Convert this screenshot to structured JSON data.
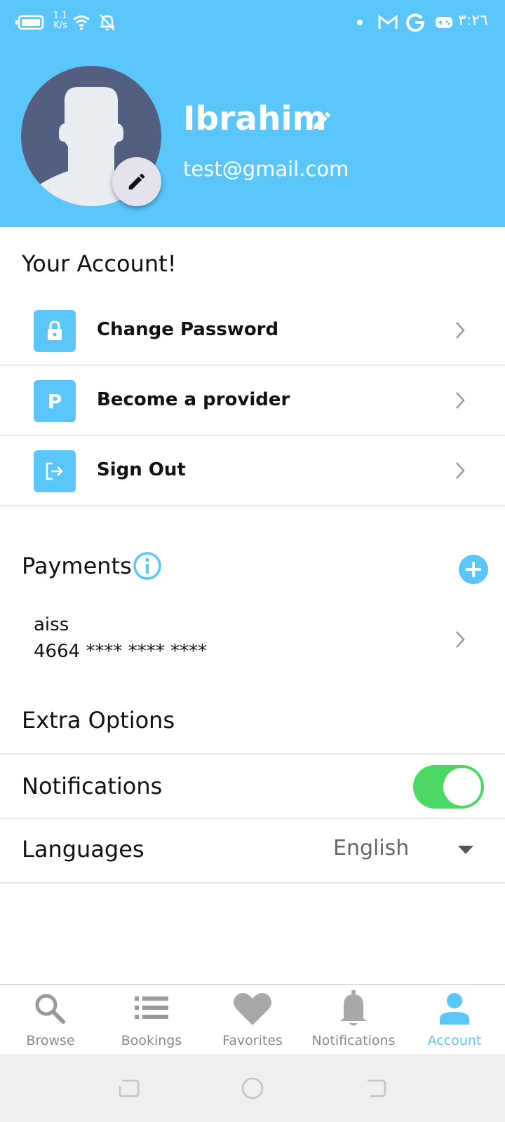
{
  "status_bar": {
    "speed_value": "1.1",
    "speed_unit": "K/s",
    "time": "٣:٢٦",
    "icons": [
      "battery-icon",
      "wifi-icon",
      "notifications-off-icon",
      "dot-icon",
      "gmail-icon",
      "google-icon",
      "game-icon"
    ]
  },
  "profile": {
    "name": "Ibrahim",
    "email": "test@gmail.com"
  },
  "account_section": {
    "title": "Your Account!",
    "items": [
      {
        "label": "Change Password",
        "icon": "lock-icon"
      },
      {
        "label": "Become a provider",
        "icon": "p-icon",
        "icon_text": "P"
      },
      {
        "label": "Sign Out",
        "icon": "sign-out-icon"
      }
    ]
  },
  "payments": {
    "title": "Payments",
    "card": {
      "holder": "aiss",
      "number": "4664 **** **** ****"
    }
  },
  "extra_options": {
    "title": "Extra Options",
    "notifications_label": "Notifications",
    "notifications_enabled": true,
    "languages_label": "Languages",
    "language_value": "English"
  },
  "bottom_nav": {
    "active": "Account",
    "items": [
      {
        "label": "Browse",
        "icon": "search-icon"
      },
      {
        "label": "Bookings",
        "icon": "list-icon"
      },
      {
        "label": "Favorites",
        "icon": "heart-icon"
      },
      {
        "label": "Notifications",
        "icon": "bell-icon"
      },
      {
        "label": "Account",
        "icon": "person-icon"
      }
    ]
  },
  "colors": {
    "primary": "#5bc6fa",
    "toggle_on": "#4cd864",
    "nav_inactive": "#8a8a8a",
    "avatar_bg": "#545e80"
  }
}
